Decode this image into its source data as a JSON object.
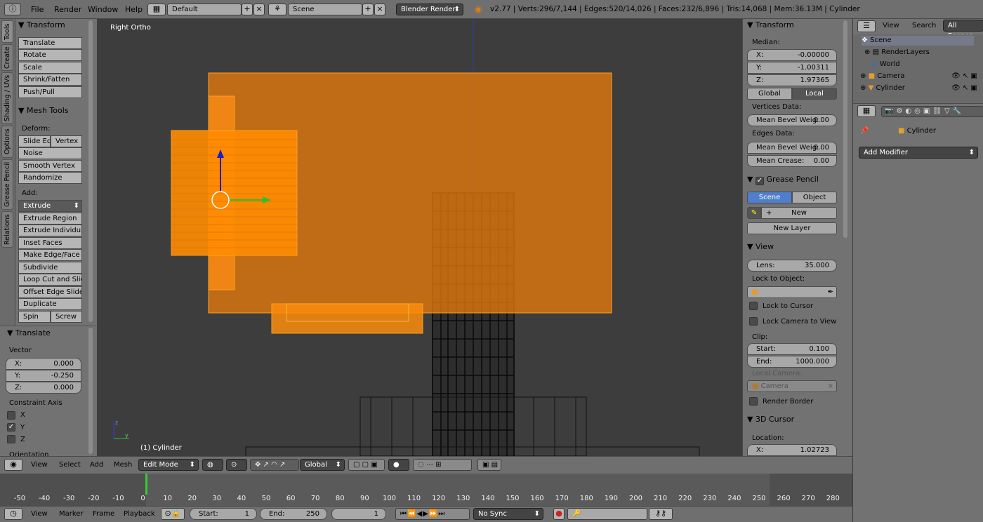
{
  "topbar": {
    "menus": [
      "File",
      "Render",
      "Window",
      "Help"
    ],
    "layout": "Default",
    "scene": "Scene",
    "engine": "Blender Render",
    "stats": "v2.77 | Verts:296/7,144 | Edges:520/14,026 | Faces:232/6,896 | Tris:14,068 | Mem:36.13M | Cylinder"
  },
  "vtabs": [
    "Tools",
    "Create",
    "Shading / UVs",
    "Options",
    "Grease Pencil",
    "Relations"
  ],
  "toolshelf": {
    "transform_title": "Transform",
    "transform_buttons": [
      "Translate",
      "Rotate",
      "Scale",
      "Shrink/Fatten",
      "Push/Pull"
    ],
    "mesh_tools_title": "Mesh Tools",
    "deform_label": "Deform:",
    "slide_edge": "Slide Ed",
    "vertex": "Vertex",
    "noise": "Noise",
    "smooth_vertex": "Smooth Vertex",
    "randomize": "Randomize",
    "add_label": "Add:",
    "extrude": "Extrude",
    "add_buttons": [
      "Extrude Region",
      "Extrude Individual",
      "Inset Faces",
      "Make Edge/Face",
      "Subdivide",
      "Loop Cut and Slide",
      "Offset Edge Slide",
      "Duplicate"
    ],
    "spin": "Spin",
    "screw": "Screw"
  },
  "redo": {
    "title": "Translate",
    "vector_label": "Vector",
    "x": {
      "k": "X:",
      "v": "0.000"
    },
    "y": {
      "k": "Y:",
      "v": "-0.250"
    },
    "z": {
      "k": "Z:",
      "v": "0.000"
    },
    "constraint_label": "Constraint Axis",
    "axes": [
      {
        "label": "X",
        "checked": false
      },
      {
        "label": "Y",
        "checked": true
      },
      {
        "label": "Z",
        "checked": false
      }
    ],
    "orientation_label": "Orientation"
  },
  "viewport": {
    "view_name": "Right Ortho",
    "object_label": "(1) Cylinder",
    "colors": {
      "selection": "#ff8c00",
      "background": "#3d3d3d"
    }
  },
  "npanel": {
    "transform_title": "Transform",
    "median_label": "Median:",
    "x": {
      "k": "X:",
      "v": "-0.00000"
    },
    "y": {
      "k": "Y:",
      "v": "-1.00311"
    },
    "z": {
      "k": "Z:",
      "v": "1.97365"
    },
    "global": "Global",
    "local": "Local",
    "vertices_data": "Vertices Data:",
    "mean_bevel_vert": {
      "k": "Mean Bevel Weig:",
      "v": "0.00"
    },
    "edges_data": "Edges Data:",
    "mean_bevel_edge": {
      "k": "Mean Bevel Weig:",
      "v": "0.00"
    },
    "mean_crease": {
      "k": "Mean Crease:",
      "v": "0.00"
    },
    "grease_pencil_title": "Grease Pencil",
    "gp_scene": "Scene",
    "gp_object": "Object",
    "gp_new": "New",
    "gp_new_layer": "New Layer",
    "view_title": "View",
    "lens": {
      "k": "Lens:",
      "v": "35.000"
    },
    "lock_to_object": "Lock to Object:",
    "lock_to_cursor": "Lock to Cursor",
    "lock_camera": "Lock Camera to View",
    "clip_label": "Clip:",
    "clip_start": {
      "k": "Start:",
      "v": "0.100"
    },
    "clip_end": {
      "k": "End:",
      "v": "1000.000"
    },
    "local_camera_label": "Local Camera:",
    "local_camera_value": "Camera",
    "render_border": "Render Border",
    "cursor_title": "3D Cursor",
    "location_label": "Location:",
    "cursor_x": {
      "k": "X:",
      "v": "1.02723"
    }
  },
  "outliner": {
    "view": "View",
    "search": "Search",
    "all_scenes": "All Scenes",
    "items": [
      "Scene",
      "RenderLayers",
      "World",
      "Camera",
      "Cylinder"
    ]
  },
  "props": {
    "object_name": "Cylinder",
    "add_modifier": "Add Modifier"
  },
  "vheader": {
    "menus": [
      "View",
      "Select",
      "Add",
      "Mesh"
    ],
    "mode": "Edit Mode",
    "orientation": "Global"
  },
  "timeline": {
    "ruler": [
      "-50",
      "-40",
      "-30",
      "-20",
      "-10",
      "0",
      "10",
      "20",
      "30",
      "40",
      "50",
      "60",
      "70",
      "80",
      "90",
      "100",
      "110",
      "120",
      "130",
      "140",
      "150",
      "160",
      "170",
      "180",
      "190",
      "200",
      "210",
      "220",
      "230",
      "240",
      "250",
      "260",
      "270",
      "280"
    ],
    "menus": [
      "View",
      "Marker",
      "Frame",
      "Playback"
    ],
    "start": {
      "k": "Start:",
      "v": "1"
    },
    "end": {
      "k": "End:",
      "v": "250"
    },
    "current": "1",
    "sync": "No Sync"
  }
}
